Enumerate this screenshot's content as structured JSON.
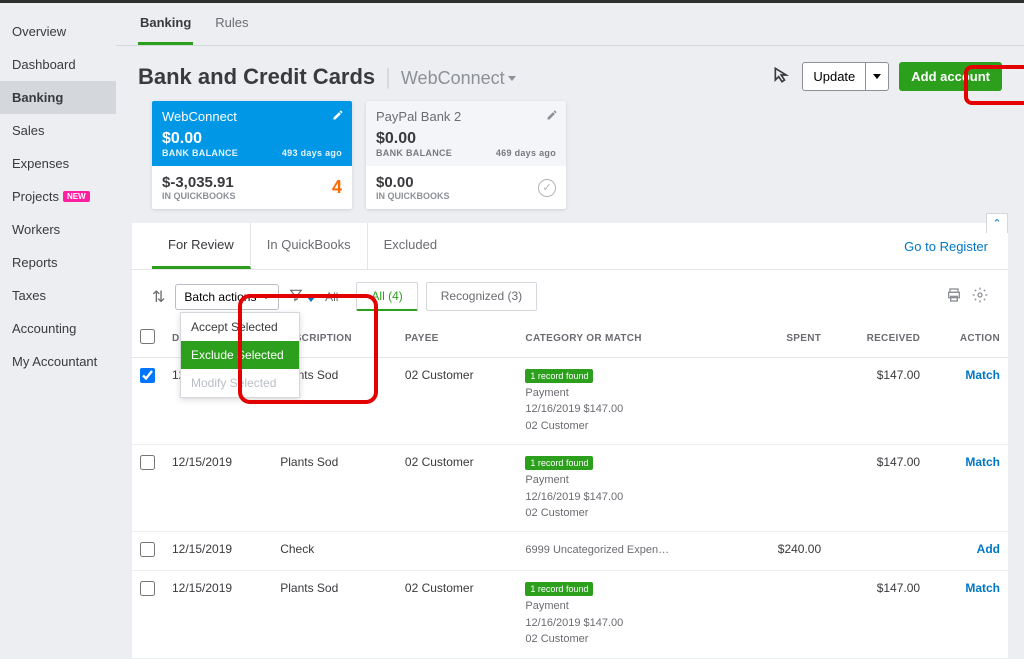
{
  "sidebar": {
    "items": [
      {
        "label": "Overview"
      },
      {
        "label": "Dashboard"
      },
      {
        "label": "Banking"
      },
      {
        "label": "Sales"
      },
      {
        "label": "Expenses"
      },
      {
        "label": "Projects"
      },
      {
        "label": "Workers"
      },
      {
        "label": "Reports"
      },
      {
        "label": "Taxes"
      },
      {
        "label": "Accounting"
      },
      {
        "label": "My Accountant"
      }
    ],
    "new_badge": "NEW"
  },
  "top_tabs": {
    "banking": "Banking",
    "rules": "Rules"
  },
  "header": {
    "title": "Bank and Credit Cards",
    "account_selector": "WebConnect",
    "update": "Update",
    "add_account": "Add account"
  },
  "cards": [
    {
      "name": "WebConnect",
      "balance": "$0.00",
      "balance_label": "BANK BALANCE",
      "age": "493 days ago",
      "qb_amount": "$-3,035.91",
      "qb_label": "IN QUICKBOOKS",
      "count": "4"
    },
    {
      "name": "PayPal Bank 2",
      "balance": "$0.00",
      "balance_label": "BANK BALANCE",
      "age": "469 days ago",
      "qb_amount": "$0.00",
      "qb_label": "IN QUICKBOOKS"
    }
  ],
  "subtabs": {
    "for_review": "For Review",
    "in_quickbooks": "In QuickBooks",
    "excluded": "Excluded",
    "go_register": "Go to Register"
  },
  "toolbar": {
    "batch": "Batch actions",
    "all_link": "All",
    "pill_all": "All (4)",
    "pill_recognized": "Recognized (3)"
  },
  "dropdown": {
    "accept": "Accept Selected",
    "exclude": "Exclude Selected",
    "modify": "Modify Selected"
  },
  "columns": {
    "date": "DATE",
    "description": "DESCRIPTION",
    "payee": "PAYEE",
    "category": "CATEGORY OR MATCH",
    "spent": "SPENT",
    "received": "RECEIVED",
    "action": "ACTION"
  },
  "record_found": "1 record found",
  "rows": [
    {
      "checked": true,
      "date": "12/15/2019",
      "description": "Plants Sod",
      "payee": "02 Customer",
      "has_match": true,
      "cat1": "Payment",
      "cat2": "12/16/2019 $147.00",
      "cat3": "02 Customer",
      "spent": "",
      "received": "$147.00",
      "action": "Match"
    },
    {
      "checked": false,
      "date": "12/15/2019",
      "description": "Plants Sod",
      "payee": "02 Customer",
      "has_match": true,
      "cat1": "Payment",
      "cat2": "12/16/2019 $147.00",
      "cat3": "02 Customer",
      "spent": "",
      "received": "$147.00",
      "action": "Match"
    },
    {
      "checked": false,
      "date": "12/15/2019",
      "description": "Check",
      "payee": "",
      "has_match": false,
      "cat1": "6999 Uncategorized Expen…",
      "cat2": "",
      "cat3": "",
      "spent": "$240.00",
      "received": "",
      "action": "Add"
    },
    {
      "checked": false,
      "date": "12/15/2019",
      "description": "Plants Sod",
      "payee": "02 Customer",
      "has_match": true,
      "cat1": "Payment",
      "cat2": "12/16/2019 $147.00",
      "cat3": "02 Customer",
      "spent": "",
      "received": "$147.00",
      "action": "Match"
    }
  ]
}
